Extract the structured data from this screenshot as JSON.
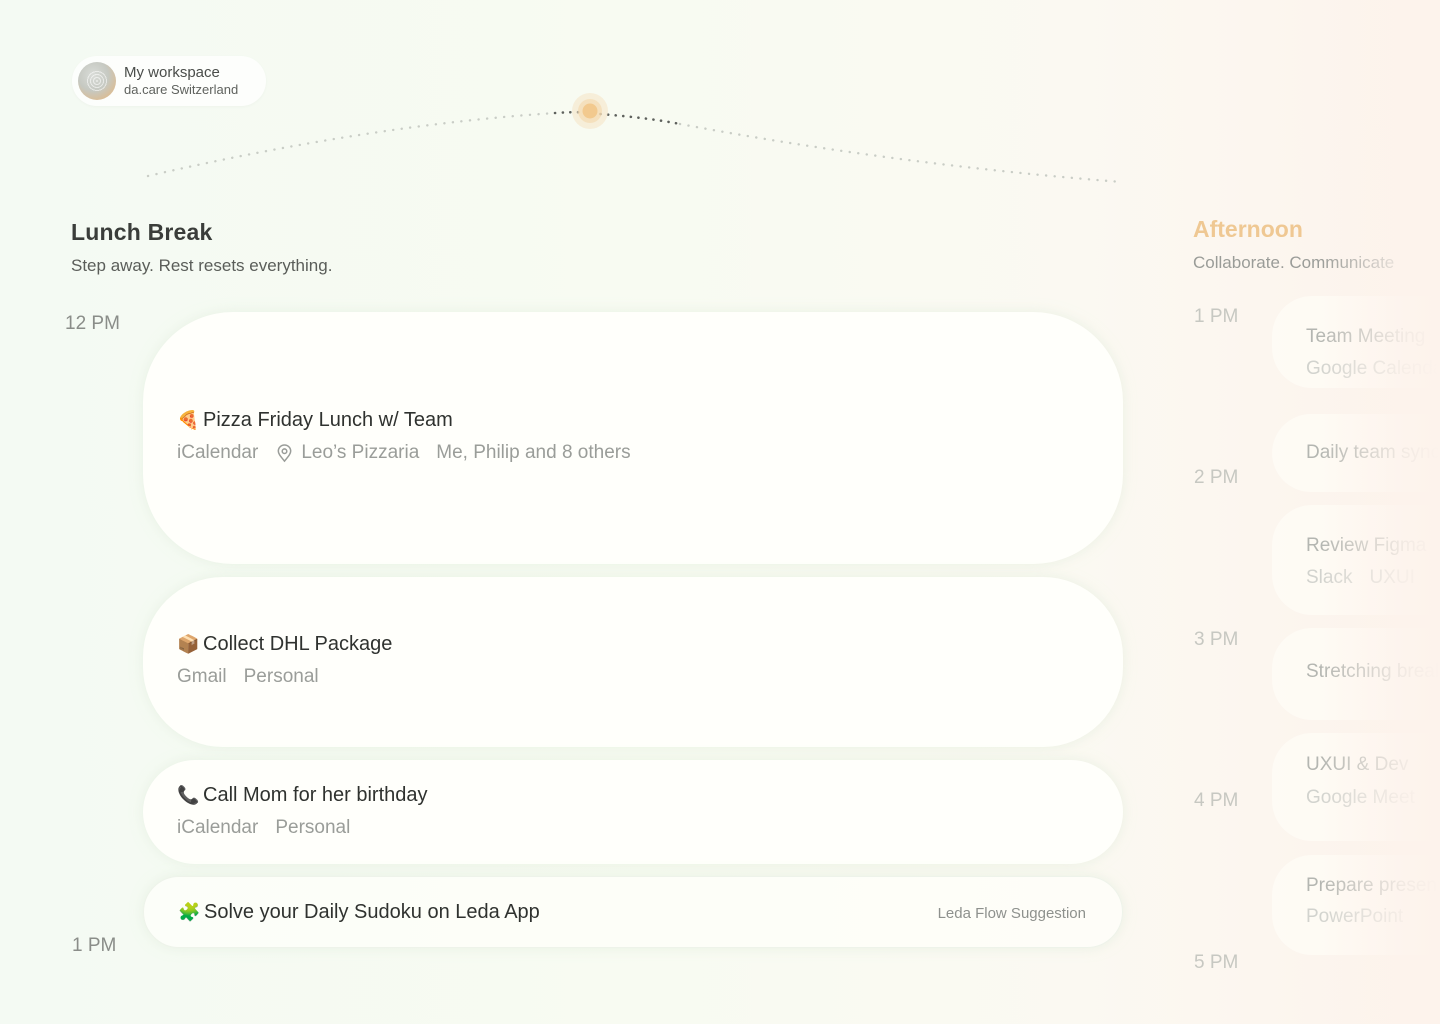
{
  "workspace": {
    "name": "My workspace",
    "subtitle": "da.care Switzerland"
  },
  "section": {
    "title": "Lunch Break",
    "subtitle": "Step away. Rest resets everything."
  },
  "times": {
    "start": "12 PM",
    "end": "1 PM"
  },
  "events": [
    {
      "emoji": "🍕",
      "title": "Pizza Friday Lunch w/ Team",
      "source": "iCalendar",
      "location": "Leo’s Pizzaria",
      "attendees": "Me, Philip and 8 others"
    },
    {
      "emoji": "📦",
      "title": "Collect DHL Package",
      "source": "Gmail",
      "tag": "Personal"
    },
    {
      "emoji": "📞",
      "title": "Call Mom for her birthday",
      "source": "iCalendar",
      "tag": "Personal"
    },
    {
      "emoji": "🧩",
      "title": "Solve your Daily Sudoku on Leda App",
      "suggestion": "Leda Flow Suggestion"
    }
  ],
  "next_section": {
    "title": "Afternoon",
    "subtitle": "Collaborate. Communicate",
    "times": [
      "1 PM",
      "2 PM",
      "3 PM",
      "4 PM",
      "5 PM"
    ],
    "events": [
      {
        "title": "Team Meeting",
        "meta": [
          "Google Calendar"
        ]
      },
      {
        "title": "Daily team sync",
        "meta": []
      },
      {
        "title": "Review Figma",
        "meta": [
          "Slack",
          "UXUI"
        ]
      },
      {
        "title": "Stretching break",
        "meta": []
      },
      {
        "title": "UXUI & Dev",
        "meta": [
          "Google Meet"
        ]
      },
      {
        "title": "Prepare presentation",
        "meta": [
          "PowerPoint"
        ]
      }
    ]
  },
  "colors": {
    "accent": "#efc893",
    "progress_dot": "#f2c98e"
  }
}
